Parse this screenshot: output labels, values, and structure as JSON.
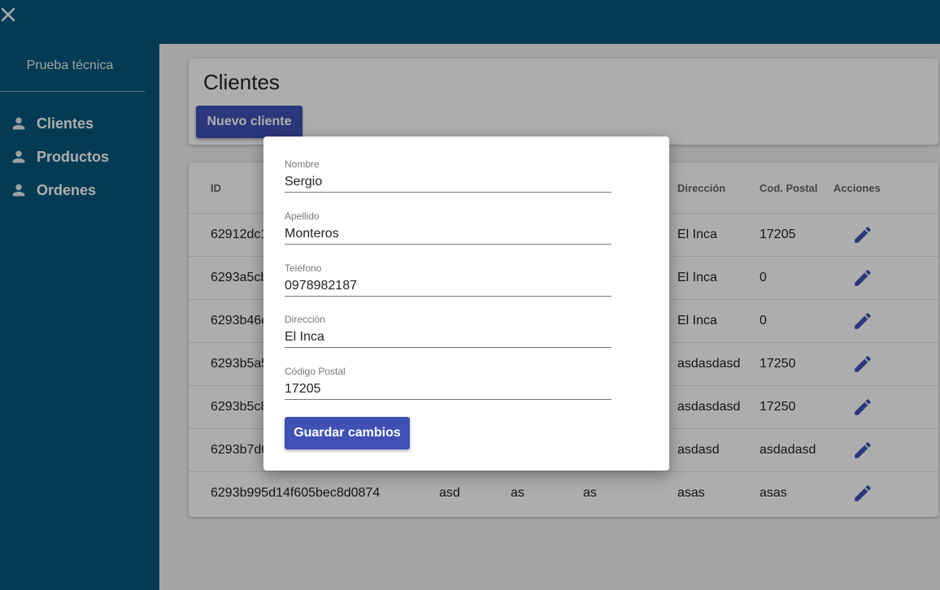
{
  "app": {
    "title": "Prueba técnica"
  },
  "sidebar": {
    "items": [
      {
        "label": "Clientes",
        "icon": "person-icon"
      },
      {
        "label": "Productos",
        "icon": "person-icon"
      },
      {
        "label": "Ordenes",
        "icon": "person-icon"
      }
    ]
  },
  "page": {
    "title": "Clientes",
    "new_button": "Nuevo cliente"
  },
  "table": {
    "headers": {
      "id": "ID",
      "direccion": "Dirección",
      "cod_postal": "Cod. Postal",
      "acciones": "Acciones"
    },
    "rows": [
      {
        "id": "62912dc1",
        "c2": "",
        "c3": "",
        "c4": "",
        "direccion": "El Inca",
        "cod_postal": "17205"
      },
      {
        "id": "6293a5cb",
        "c2": "",
        "c3": "",
        "c4": "",
        "direccion": "El Inca",
        "cod_postal": "0"
      },
      {
        "id": "6293b46e",
        "c2": "",
        "c3": "",
        "c4": "",
        "direccion": "El Inca",
        "cod_postal": "0"
      },
      {
        "id": "6293b5a5",
        "c2": "",
        "c3": "",
        "c4": "",
        "direccion": "asdasdasd",
        "cod_postal": "17250"
      },
      {
        "id": "6293b5c8",
        "c2": "",
        "c3": "",
        "c4": "",
        "direccion": "asdasdasd",
        "cod_postal": "17250"
      },
      {
        "id": "6293b7d6",
        "c2": "",
        "c3": "",
        "c4": "",
        "direccion": "asdasd",
        "cod_postal": "asdadasd"
      },
      {
        "id": "6293b995d14f605bec8d0874",
        "c2": "asd",
        "c3": "as",
        "c4": "as",
        "direccion": "asas",
        "cod_postal": "asas"
      }
    ]
  },
  "dialog": {
    "fields": [
      {
        "label": "Nombre",
        "value": "Sergio"
      },
      {
        "label": "Apellido",
        "value": "Monteros"
      },
      {
        "label": "Teléfono",
        "value": "0978982187"
      },
      {
        "label": "Dirección",
        "value": "El Inca"
      },
      {
        "label": "Código Postal",
        "value": "17205"
      }
    ],
    "save_button": "Guardar cambios"
  },
  "colors": {
    "primary": "#06587d",
    "accent": "#3f51b5"
  }
}
